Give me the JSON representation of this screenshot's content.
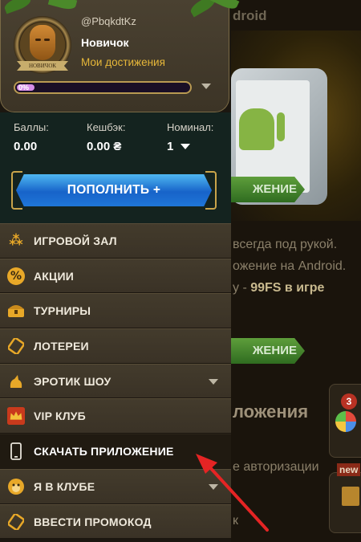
{
  "background_page": {
    "title_fragment": "droid",
    "button_label": "ЖЕНИЕ",
    "text_line1": "всегда под рукой.",
    "text_line2": "ожение на Android.",
    "text_line3_prefix": "у - ",
    "text_line3_bold": "99FS в игре",
    "heading": "ложения",
    "text_line4": "е авторизации",
    "text_line5": "к",
    "badge_count": "3",
    "new_label": "new"
  },
  "profile": {
    "username": "@PbqkdtKz",
    "rank": "Новичок",
    "rank_ribbon": "НОВИЧОК",
    "achievements_link": "Мои достижения",
    "progress_label": "0%",
    "progress_value": 0
  },
  "balance": {
    "points_label": "Баллы:",
    "points_value": "0.00",
    "cashback_label": "Кешбэк:",
    "cashback_value": "0.00 ₴",
    "nominal_label": "Номинал:",
    "nominal_value": "1"
  },
  "deposit_button": "ПОПОЛНИТЬ +",
  "menu": [
    {
      "label": "ИГРОВОЙ ЗАЛ",
      "icon": "slots-icon",
      "has_dropdown": false
    },
    {
      "label": "АКЦИИ",
      "icon": "percent-icon",
      "has_dropdown": false
    },
    {
      "label": "ТУРНИРЫ",
      "icon": "treasure-chest-icon",
      "has_dropdown": false
    },
    {
      "label": "ЛОТЕРЕИ",
      "icon": "ticket-icon",
      "has_dropdown": false
    },
    {
      "label": "ЭРОТИК ШОУ",
      "icon": "erotic-show-icon",
      "has_dropdown": true
    },
    {
      "label": "VIP КЛУБ",
      "icon": "crown-icon",
      "has_dropdown": false
    },
    {
      "label": "СКАЧАТЬ ПРИЛОЖЕНИЕ",
      "icon": "smartphone-icon",
      "has_dropdown": false
    },
    {
      "label": "Я В КЛУБЕ",
      "icon": "monkey-icon",
      "has_dropdown": true
    },
    {
      "label": "ВВЕСТИ ПРОМОКОД",
      "icon": "promo-ticket-icon",
      "has_dropdown": false
    }
  ],
  "colors": {
    "accent_gold": "#e6b739",
    "deposit_blue": "#1763c9",
    "annotation_arrow": "#e52424"
  }
}
